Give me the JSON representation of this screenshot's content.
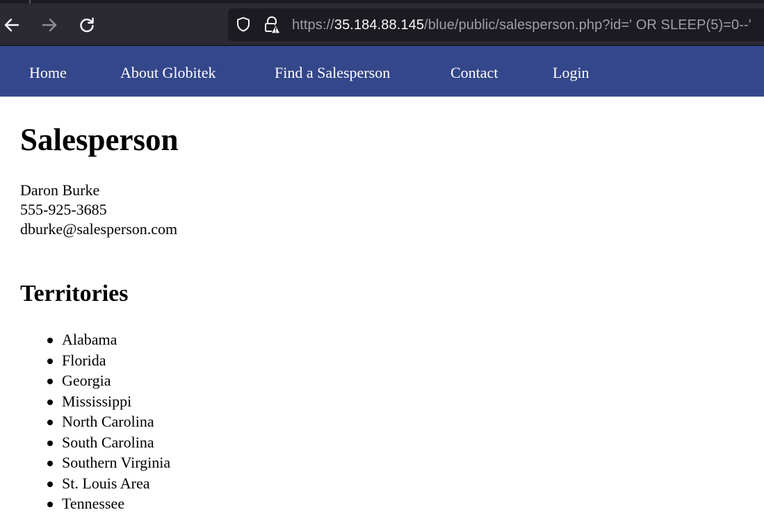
{
  "browser": {
    "url_prefix": "https://",
    "url_host": "35.184.88.145",
    "url_rest": "/blue/public/salesperson.php?id=' OR SLEEP(5)=0--'"
  },
  "nav": {
    "items": [
      {
        "label": "Home"
      },
      {
        "label": "About Globitek"
      },
      {
        "label": "Find a Salesperson"
      },
      {
        "label": "Contact"
      },
      {
        "label": "Login"
      }
    ]
  },
  "page": {
    "title": "Salesperson",
    "salesperson": {
      "name": "Daron Burke",
      "phone": "555-925-3685",
      "email": "dburke@salesperson.com"
    },
    "territories_heading": "Territories",
    "territories": [
      "Alabama",
      "Florida",
      "Georgia",
      "Mississippi",
      "North Carolina",
      "South Carolina",
      "Southern Virginia",
      "St. Louis Area",
      "Tennessee"
    ]
  },
  "colors": {
    "nav_background": "#34478a",
    "browser_toolbar": "#2b2a33",
    "url_field": "#1c1b22"
  },
  "icons": {
    "back": "arrow-left-icon",
    "forward": "arrow-right-icon",
    "reload": "reload-icon",
    "tracking": "shield-icon",
    "security": "lock-warning-icon"
  }
}
